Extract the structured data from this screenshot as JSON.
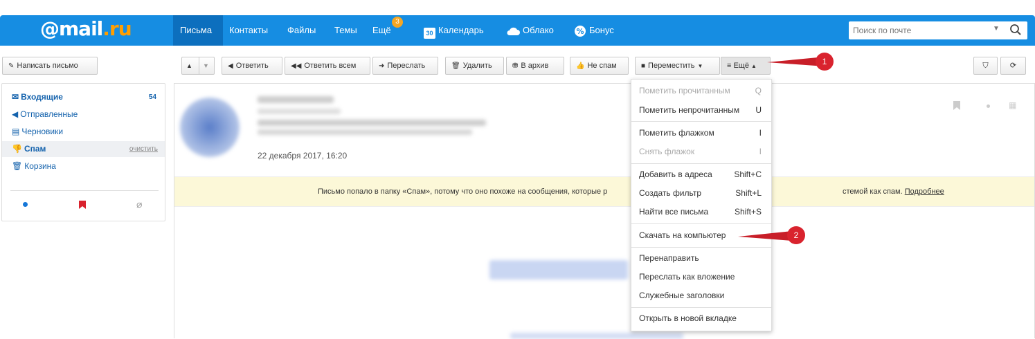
{
  "header": {
    "logo_at": "@",
    "logo_mail": "mail",
    "logo_ru": ".ru",
    "nav": [
      "Письма",
      "Контакты",
      "Файлы",
      "Темы",
      "Ещё"
    ],
    "more_badge": "3",
    "calendar_label": "Календарь",
    "calendar_day": "30",
    "cloud_label": "Облако",
    "bonus_label": "Бонус",
    "search_placeholder": "Поиск по почте"
  },
  "toolbar": {
    "compose": "Написать письмо",
    "reply": "Ответить",
    "reply_all": "Ответить всем",
    "forward": "Переслать",
    "delete": "Удалить",
    "archive": "В архив",
    "not_spam": "Не спам",
    "move": "Переместить",
    "more": "≡ Ещё"
  },
  "sidebar": {
    "folders": [
      {
        "label": "Входящие",
        "count": "54"
      },
      {
        "label": "Отправленные"
      },
      {
        "label": "Черновики"
      },
      {
        "label": "Спам",
        "action": "очистить"
      },
      {
        "label": "Корзина"
      }
    ]
  },
  "message": {
    "date": "22 декабря 2017, 16:20",
    "spam_notice_part1": "Письмо попало в папку «Спам», потому что оно похоже на сообщения, которые р",
    "spam_notice_part2": "стемой как спам.",
    "spam_link": "Подробнее"
  },
  "more_menu": {
    "items": [
      {
        "label": "Пометить прочитанным",
        "key": "Q",
        "disabled": true
      },
      {
        "label": "Пометить непрочитанным",
        "key": "U"
      },
      {
        "label": "Пометить флажком",
        "key": "I"
      },
      {
        "label": "Снять флажок",
        "key": "I",
        "disabled": true
      },
      {
        "label": "Добавить в адреса",
        "key": "Shift+C"
      },
      {
        "label": "Создать фильтр",
        "key": "Shift+L"
      },
      {
        "label": "Найти все письма",
        "key": "Shift+S"
      },
      {
        "label": "Скачать на компьютер"
      },
      {
        "label": "Перенаправить"
      },
      {
        "label": "Переслать как вложение"
      },
      {
        "label": "Служебные заголовки"
      },
      {
        "label": "Открыть в новой вкладке"
      }
    ]
  },
  "callouts": [
    "1",
    "2"
  ],
  "colors": {
    "header_blue": "#168de2",
    "callout_red": "#d9232e",
    "spam_bar": "#fcf8d8"
  }
}
